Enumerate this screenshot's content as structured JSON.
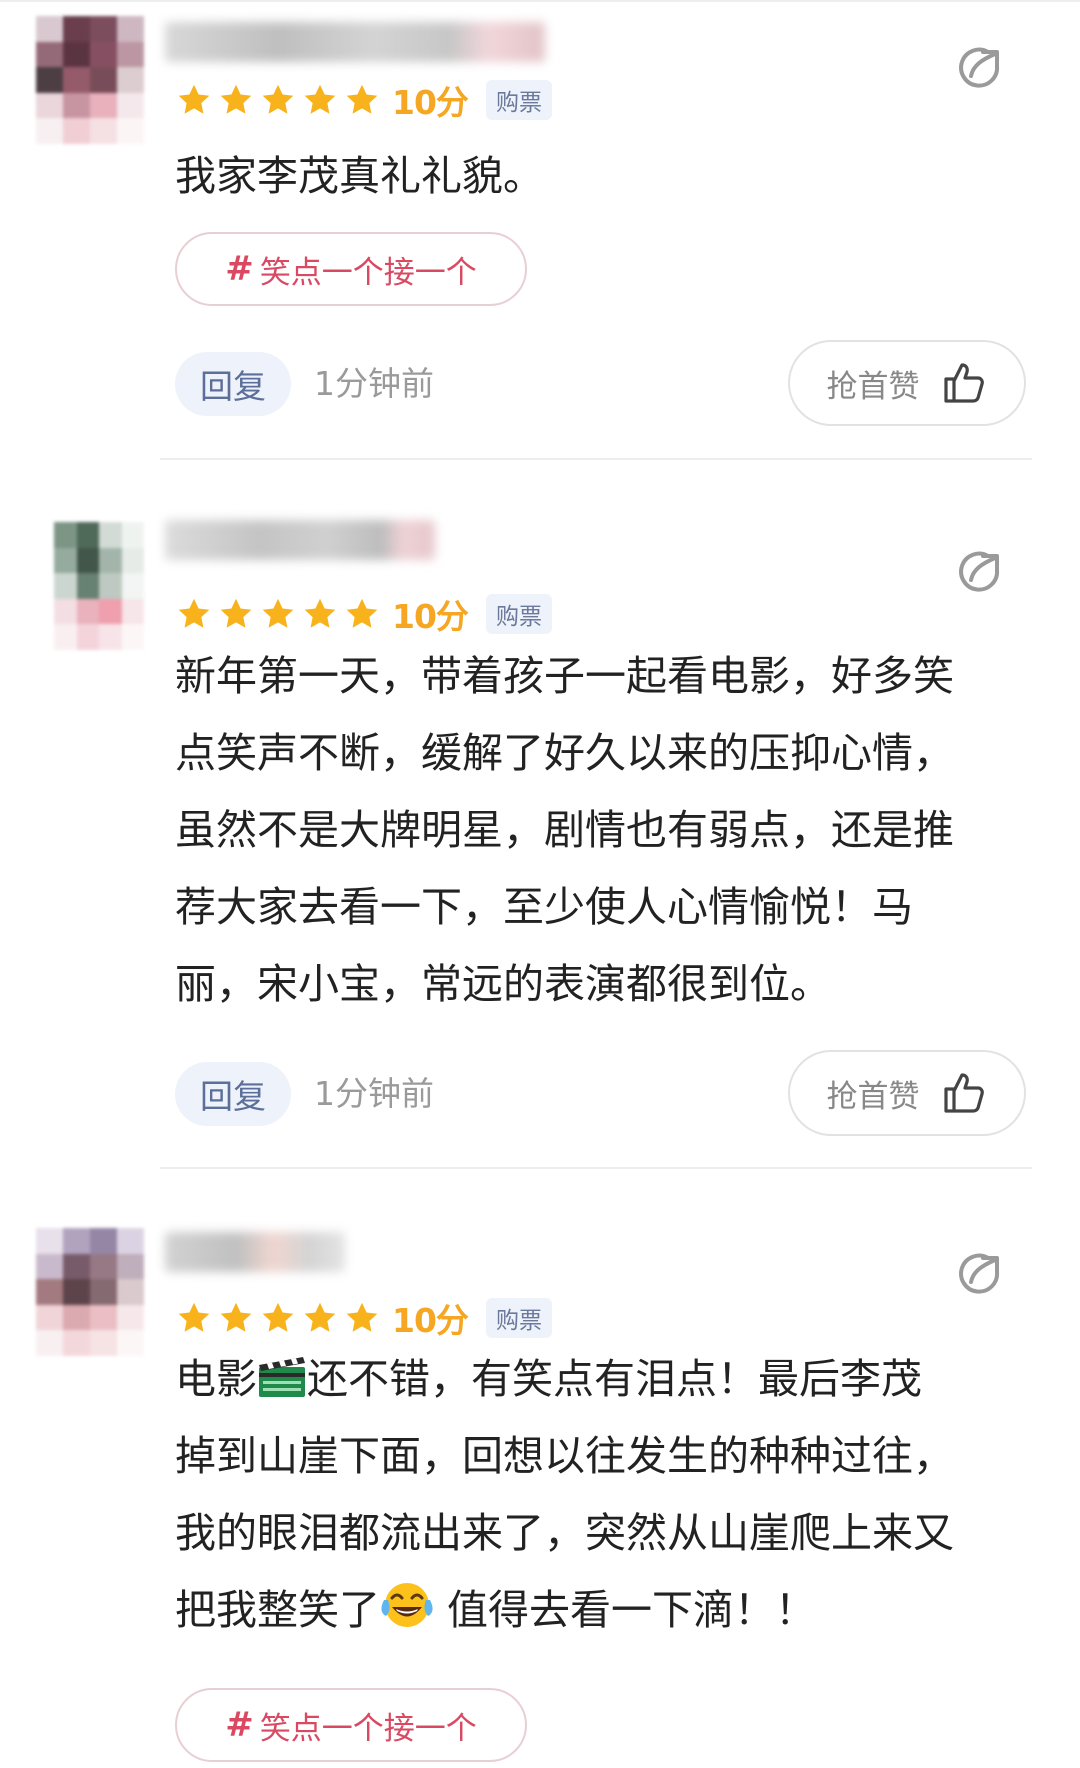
{
  "reviews": [
    {
      "score": "10分",
      "badge": "购票",
      "text": "我家李茂真礼礼貌。",
      "tag": "笑点一个接一个",
      "reply": "回复",
      "time": "1分钟前",
      "like": "抢首赞",
      "rating_stars": 5
    },
    {
      "score": "10分",
      "badge": "购票",
      "text_lines": [
        "新年第一天，带着孩子一起看电影，好多笑",
        "点笑声不断，缓解了好久以来的压抑心情，",
        "虽然不是大牌明星，剧情也有弱点，还是推",
        "荐大家去看一下，至少使人心情愉悦！马",
        "丽，宋小宝，常远的表演都很到位。"
      ],
      "reply": "回复",
      "time": "1分钟前",
      "like": "抢首赞",
      "rating_stars": 5
    },
    {
      "score": "10分",
      "badge": "购票",
      "text_parts": {
        "l1a": "电影",
        "l1b": "还不错，有笑点有泪点！最后李茂",
        "l2": "掉到山崖下面，回想以往发生的种种过往，",
        "l3": "我的眼泪都流出来了，突然从山崖爬上来又",
        "l4a": "把我整笑了",
        "l4b": "值得去看一下滴！！"
      },
      "tag": "笑点一个接一个",
      "rating_stars": 5
    }
  ],
  "icons": {
    "star": "star-icon",
    "share": "share-icon",
    "thumb": "thumbs-up-icon",
    "clapper": "clapperboard-emoji",
    "laugh": "tears-of-joy-emoji"
  },
  "colors": {
    "star": "#f7b21c",
    "score": "#f5a623",
    "tag_text": "#d94a62",
    "reply_text": "#5c6f9a"
  }
}
